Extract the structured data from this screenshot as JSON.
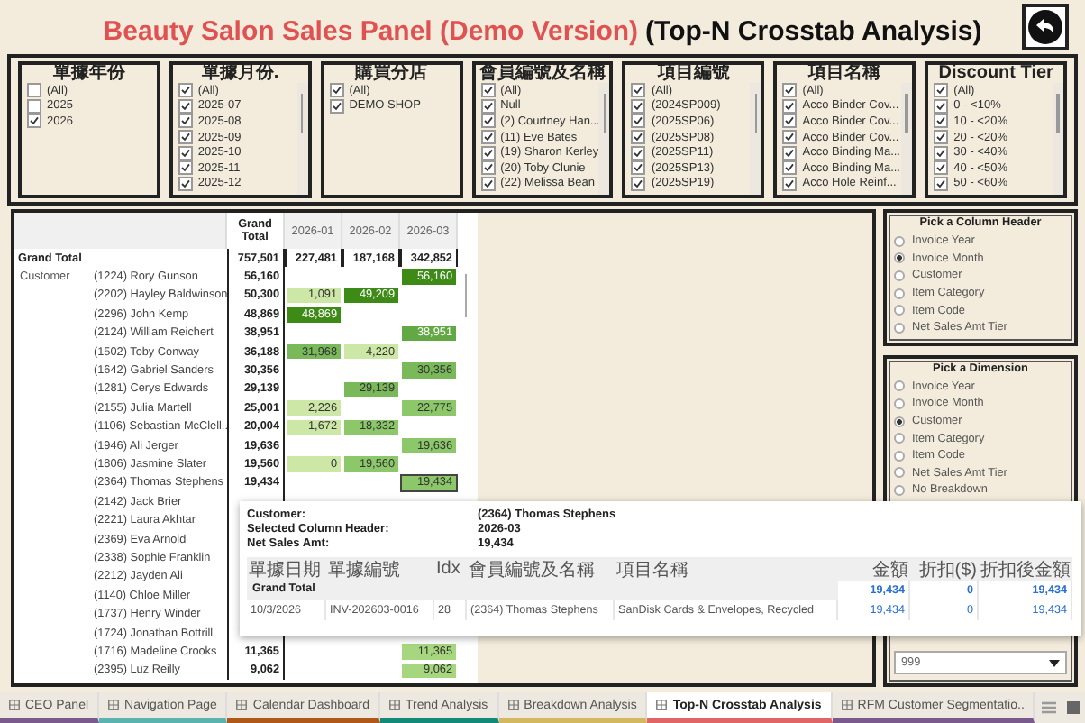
{
  "title": {
    "main": "Beauty Salon Sales Panel (Demo Version)",
    "sub": "(Top-N Crosstab Analysis)"
  },
  "filters": [
    {
      "title": "單據年份",
      "kind": "plain",
      "items": [
        {
          "label": "(All)",
          "checked": false
        },
        {
          "label": "2025",
          "checked": false
        },
        {
          "label": "2026",
          "checked": true
        }
      ]
    },
    {
      "title": "單據月份.",
      "kind": "scroll",
      "items": [
        {
          "label": "(All)",
          "checked": true
        },
        {
          "label": "2025-07",
          "checked": true
        },
        {
          "label": "2025-08",
          "checked": true
        },
        {
          "label": "2025-09",
          "checked": true
        },
        {
          "label": "2025-10",
          "checked": true
        },
        {
          "label": "2025-11",
          "checked": true
        },
        {
          "label": "2025-12",
          "checked": true
        }
      ]
    },
    {
      "title": "購買分店",
      "kind": "plain",
      "items": [
        {
          "label": "(All)",
          "checked": true
        },
        {
          "label": "DEMO SHOP",
          "checked": true
        }
      ]
    },
    {
      "title": "會員編號及名稱",
      "kind": "scroll",
      "items": [
        {
          "label": "(All)",
          "checked": true
        },
        {
          "label": "Null",
          "checked": true
        },
        {
          "label": "(2) Courtney Han...",
          "checked": true
        },
        {
          "label": "(11) Eve Bates",
          "checked": true
        },
        {
          "label": "(19) Sharon Kerley",
          "checked": true
        },
        {
          "label": "(20) Toby Clunie",
          "checked": true
        },
        {
          "label": "(22) Melissa Bean",
          "checked": true
        }
      ]
    },
    {
      "title": "項目編號",
      "kind": "scroll",
      "items": [
        {
          "label": "(All)",
          "checked": true
        },
        {
          "label": "(2024SP009)",
          "checked": true
        },
        {
          "label": "(2025SP06)",
          "checked": true
        },
        {
          "label": "(2025SP08)",
          "checked": true
        },
        {
          "label": "(2025SP11)",
          "checked": true
        },
        {
          "label": "(2025SP13)",
          "checked": true
        },
        {
          "label": "(2025SP19)",
          "checked": true
        }
      ]
    },
    {
      "title": "項目名稱",
      "kind": "scroll",
      "items": [
        {
          "label": "(All)",
          "checked": true
        },
        {
          "label": "Acco Binder Cov...",
          "checked": true
        },
        {
          "label": "Acco Binder Cov...",
          "checked": true
        },
        {
          "label": "Acco Binder Cov...",
          "checked": true
        },
        {
          "label": "Acco Binding Ma...",
          "checked": true
        },
        {
          "label": "Acco Binding Ma...",
          "checked": true
        },
        {
          "label": "Acco Hole Reinf...",
          "checked": true
        }
      ]
    },
    {
      "title": "Discount Tier",
      "kind": "scroll",
      "items": [
        {
          "label": "(All)",
          "checked": true
        },
        {
          "label": "0  - <10%",
          "checked": true
        },
        {
          "label": "10 - <20%",
          "checked": true
        },
        {
          "label": "20 - <20%",
          "checked": true
        },
        {
          "label": "30 - <40%",
          "checked": true
        },
        {
          "label": "40 - <50%",
          "checked": true
        },
        {
          "label": "50 - <60%",
          "checked": true
        }
      ]
    }
  ],
  "table": {
    "columns": [
      "Grand Total",
      "2026-01",
      "2026-02",
      "2026-03"
    ],
    "row_group": "Customer",
    "grand_total": {
      "label": "Grand Total",
      "values": [
        "757,501",
        "227,481",
        "187,168",
        "342,852"
      ]
    },
    "rows": [
      {
        "name": "(1224) Rory Gunson",
        "cells": [
          {
            "kind": "total",
            "value": "56,160"
          },
          null,
          null,
          {
            "kind": "heat",
            "value": "56,160",
            "color": "#3d8a16",
            "selected": false
          }
        ]
      },
      {
        "name": "(2202) Hayley Baldwinson",
        "cells": [
          {
            "kind": "total",
            "value": "50,300"
          },
          {
            "kind": "heat",
            "value": "1,091",
            "color": "#cde7a6",
            "selected": false
          },
          {
            "kind": "heat",
            "value": "49,209",
            "color": "#3d8a16",
            "selected": false
          },
          null
        ]
      },
      {
        "name": "(2296) John Kemp",
        "cells": [
          {
            "kind": "total",
            "value": "48,869"
          },
          {
            "kind": "heat",
            "value": "48,869",
            "color": "#3d8a16",
            "selected": false
          },
          null,
          null
        ]
      },
      {
        "name": "(2124) William Reichert",
        "cells": [
          {
            "kind": "total",
            "value": "38,951"
          },
          null,
          null,
          {
            "kind": "heat",
            "value": "38,951",
            "color": "#62a844",
            "selected": false
          }
        ]
      },
      {
        "name": "(1502) Toby Conway",
        "cells": [
          {
            "kind": "total",
            "value": "36,188"
          },
          {
            "kind": "heat",
            "value": "31,968",
            "color": "#7ab95a",
            "selected": false
          },
          {
            "kind": "heat",
            "value": "4,220",
            "color": "#cde7a6",
            "selected": false
          },
          null
        ]
      },
      {
        "name": "(1642) Gabriel Sanders",
        "cells": [
          {
            "kind": "total",
            "value": "30,356"
          },
          null,
          null,
          {
            "kind": "heat",
            "value": "30,356",
            "color": "#7ab95a",
            "selected": false
          }
        ]
      },
      {
        "name": "(1281) Cerys Edwards",
        "cells": [
          {
            "kind": "total",
            "value": "29,139"
          },
          null,
          {
            "kind": "heat",
            "value": "29,139",
            "color": "#7ab95a",
            "selected": false
          },
          null
        ]
      },
      {
        "name": "(2155) Julia Martell",
        "cells": [
          {
            "kind": "total",
            "value": "25,001"
          },
          {
            "kind": "heat",
            "value": "2,226",
            "color": "#cde7a6",
            "selected": false
          },
          null,
          {
            "kind": "heat",
            "value": "22,775",
            "color": "#8cc86a",
            "selected": false
          }
        ]
      },
      {
        "name": "(1106) Sebastian McClell..",
        "cells": [
          {
            "kind": "total",
            "value": "20,004"
          },
          {
            "kind": "heat",
            "value": "1,672",
            "color": "#cde7a6",
            "selected": false
          },
          {
            "kind": "heat",
            "value": "18,332",
            "color": "#8cc86a",
            "selected": false
          },
          null
        ]
      },
      {
        "name": "(1946) Ali Jerger",
        "cells": [
          {
            "kind": "total",
            "value": "19,636"
          },
          null,
          null,
          {
            "kind": "heat",
            "value": "19,636",
            "color": "#8cc86a",
            "selected": false
          }
        ]
      },
      {
        "name": "(1806) Jasmine Slater",
        "cells": [
          {
            "kind": "total",
            "value": "19,560"
          },
          {
            "kind": "heat",
            "value": "0",
            "color": "#cde7a6",
            "selected": false
          },
          {
            "kind": "heat",
            "value": "19,560",
            "color": "#8cc86a",
            "selected": false
          },
          null
        ]
      },
      {
        "name": "(2364) Thomas Stephens",
        "cells": [
          {
            "kind": "total",
            "value": "19,434"
          },
          null,
          null,
          {
            "kind": "heat",
            "value": "19,434",
            "color": "#8cc86a",
            "selected": true
          }
        ]
      },
      {
        "name": "(2142) Jack Brier",
        "cells": [
          null,
          null,
          null,
          null
        ]
      },
      {
        "name": "(2221) Laura Akhtar",
        "cells": [
          null,
          null,
          null,
          null
        ]
      },
      {
        "name": "(2369) Eva Arnold",
        "cells": [
          null,
          null,
          null,
          null
        ]
      },
      {
        "name": "(2338) Sophie Franklin",
        "cells": [
          null,
          null,
          null,
          null
        ]
      },
      {
        "name": "(2212) Jayden Ali",
        "cells": [
          null,
          null,
          null,
          null
        ]
      },
      {
        "name": "(1140) Chloe Miller",
        "cells": [
          null,
          null,
          null,
          null
        ]
      },
      {
        "name": "(1737) Henry Winder",
        "cells": [
          null,
          null,
          null,
          null
        ]
      },
      {
        "name": "(1724) Jonathan Bottrill",
        "cells": [
          null,
          null,
          null,
          null
        ]
      },
      {
        "name": "(1716) Madeline Crooks",
        "cells": [
          {
            "kind": "total",
            "value": "11,365"
          },
          null,
          null,
          {
            "kind": "heat",
            "value": "11,365",
            "color": "#a6d67e",
            "selected": false
          }
        ]
      },
      {
        "name": "(2395) Luz Reilly",
        "cells": [
          {
            "kind": "total",
            "value": "9,062"
          },
          null,
          null,
          {
            "kind": "heat",
            "value": "9,062",
            "color": "#a6d67e",
            "selected": false
          }
        ]
      }
    ]
  },
  "pickers": [
    {
      "title": "Pick a Column Header",
      "options": [
        {
          "label": "Invoice Year",
          "selected": false
        },
        {
          "label": "Invoice Month",
          "selected": true
        },
        {
          "label": "Customer",
          "selected": false
        },
        {
          "label": "Item Category",
          "selected": false
        },
        {
          "label": "Item Code",
          "selected": false
        },
        {
          "label": "Net Sales Amt Tier",
          "selected": false
        }
      ]
    },
    {
      "title": "Pick a Dimension",
      "options": [
        {
          "label": "Invoice Year",
          "selected": false
        },
        {
          "label": "Invoice Month",
          "selected": false
        },
        {
          "label": "Customer",
          "selected": true
        },
        {
          "label": "Item Category",
          "selected": false
        },
        {
          "label": "Item Code",
          "selected": false
        },
        {
          "label": "Net Sales Amt Tier",
          "selected": false
        },
        {
          "label": "No Breakdown",
          "selected": false
        }
      ]
    }
  ],
  "topn": {
    "value": "999"
  },
  "tooltip": {
    "fields": [
      {
        "label": "Customer:",
        "value": "(2364) Thomas Stephens"
      },
      {
        "label": "Selected Column Header:",
        "value": "2026-03"
      },
      {
        "label": "Net Sales Amt:",
        "value": "19,434"
      }
    ],
    "columns": [
      "單據日期",
      "單據編號",
      "Idx",
      "會員編號及名稱",
      "項目名稱",
      "金額",
      "折扣($)",
      "折扣後金額"
    ],
    "total": {
      "label": "Grand Total",
      "values": [
        "19,434",
        "0",
        "19,434"
      ]
    },
    "rows": [
      [
        "10/3/2026",
        "INV-202603-0016",
        "28",
        "(2364) Thomas Stephens",
        "SanDisk Cards & Envelopes, Recycled",
        "19,434",
        "0",
        "19,434"
      ]
    ]
  },
  "tabs": [
    {
      "label": "CEO Panel",
      "selected": false,
      "color": "#7a5a8c"
    },
    {
      "label": "Navigation Page",
      "selected": false,
      "color": "#5bb3b0"
    },
    {
      "label": "Calendar Dashboard",
      "selected": false,
      "color": "#b0581a"
    },
    {
      "label": "Trend Analysis",
      "selected": false,
      "color": "#13897a"
    },
    {
      "label": "Breakdown Analysis",
      "selected": false,
      "color": "#d4b860"
    },
    {
      "label": "Top-N Crosstab Analysis",
      "selected": true,
      "color": "#e06666"
    },
    {
      "label": "RFM Customer Segmentatio..",
      "selected": false,
      "color": "#7a5a8c"
    }
  ]
}
